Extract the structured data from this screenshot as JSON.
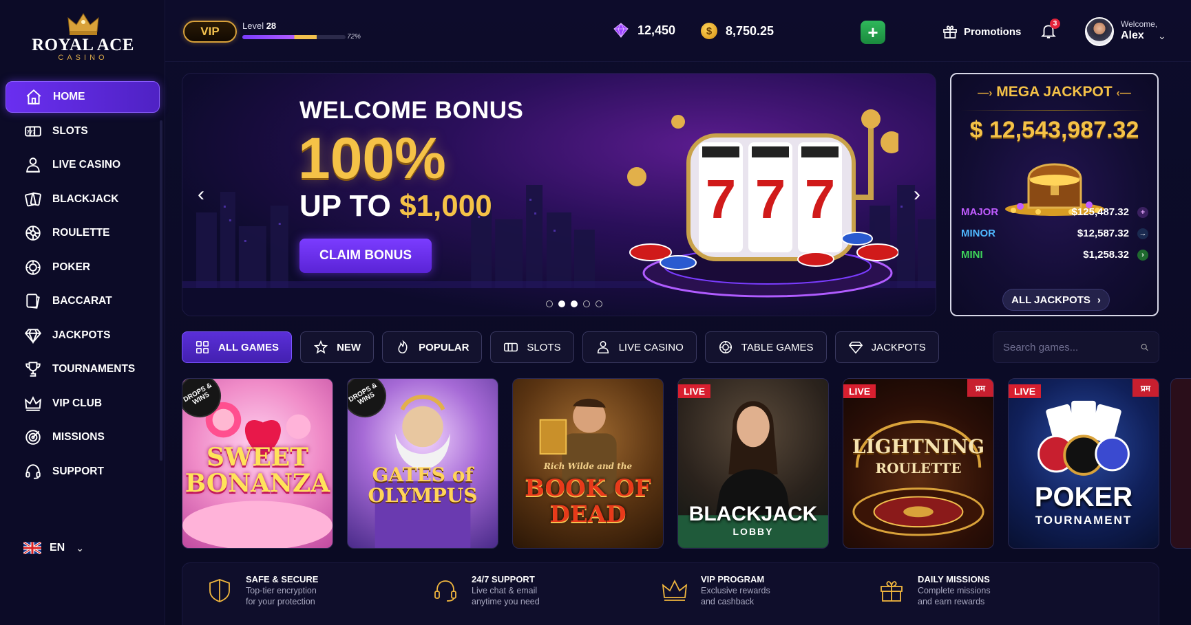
{
  "brand": {
    "name": "ROYAL ACE",
    "sub": "CASINO"
  },
  "sidebar": {
    "items": [
      {
        "label": "HOME",
        "icon": "home-icon",
        "active": true
      },
      {
        "label": "SLOTS",
        "icon": "slots-icon"
      },
      {
        "label": "LIVE CASINO",
        "icon": "dealer-icon"
      },
      {
        "label": "BLACKJACK",
        "icon": "cards-icon"
      },
      {
        "label": "ROULETTE",
        "icon": "roulette-icon"
      },
      {
        "label": "POKER",
        "icon": "chip-icon"
      },
      {
        "label": "BACCARAT",
        "icon": "baccarat-icon"
      },
      {
        "label": "JACKPOTS",
        "icon": "diamond-icon"
      },
      {
        "label": "TOURNAMENTS",
        "icon": "trophy-icon"
      },
      {
        "label": "VIP CLUB",
        "icon": "crown-icon"
      },
      {
        "label": "MISSIONS",
        "icon": "target-icon"
      },
      {
        "label": "SUPPORT",
        "icon": "headset-icon"
      }
    ],
    "language": "EN"
  },
  "header": {
    "vip_label": "VIP",
    "level_label": "Level",
    "level_value": "28",
    "level_progress_pct": "72%",
    "level_progress": 0.72,
    "gems": "12,450",
    "coin_symbol": "$",
    "coins": "8,750.25",
    "add_label": "+",
    "promotions": "Promotions",
    "notifications": "3",
    "welcome": "Welcome,",
    "user": "Alex"
  },
  "hero": {
    "title": "WELCOME BONUS",
    "percent": "100%",
    "upto": "UP TO",
    "amount": "$1,000",
    "cta": "CLAIM BONUS",
    "slides": 5,
    "active_slide": 2
  },
  "jackpot": {
    "title": "MEGA JACKPOT",
    "amount": "$ 12,543,987.32",
    "tiers": [
      {
        "name": "MAJOR",
        "value": "$125,487.32",
        "color": "#c05cff"
      },
      {
        "name": "MINOR",
        "value": "$12,587.32",
        "color": "#4fb8ff"
      },
      {
        "name": "MINI",
        "value": "$1,258.32",
        "color": "#3ed45a"
      }
    ],
    "all_label": "ALL JACKPOTS"
  },
  "filters": {
    "chips": [
      {
        "label": "ALL GAMES",
        "icon": "grid-icon",
        "active": true
      },
      {
        "label": "NEW",
        "icon": "star-icon"
      },
      {
        "label": "POPULAR",
        "icon": "fire-icon"
      },
      {
        "label": "SLOTS",
        "icon": "slots-icon"
      },
      {
        "label": "LIVE CASINO",
        "icon": "dealer-icon"
      },
      {
        "label": "TABLE GAMES",
        "icon": "chip-icon"
      },
      {
        "label": "JACKPOTS",
        "icon": "diamond-icon"
      }
    ],
    "search_placeholder": "Search games..."
  },
  "games": [
    {
      "title": "SWEET BONANZA",
      "badge": "DROPS & WINS",
      "live": ""
    },
    {
      "title": "GATES of OLYMPUS",
      "badge": "DROPS & WINS",
      "live": ""
    },
    {
      "title": "BOOK OF DEAD",
      "subtitle": "Rich Wilde and the",
      "badge": "",
      "live": ""
    },
    {
      "title": "BLACKJACK",
      "subtitle": "LOBBY",
      "live": "LIVE"
    },
    {
      "title": "LIGHTNING",
      "subtitle": "ROULETTE",
      "live": "LIVE",
      "corner": "प्रम"
    },
    {
      "title": "POKER",
      "subtitle": "TOURNAMENT",
      "live": "LIVE",
      "corner": "प्रम"
    }
  ],
  "features": [
    {
      "title": "SAFE & SECURE",
      "line1": "Top-tier encryption",
      "line2": "for your protection",
      "icon": "shield-icon"
    },
    {
      "title": "24/7 SUPPORT",
      "line1": "Live chat & email",
      "line2": "anytime you need",
      "icon": "headset-icon"
    },
    {
      "title": "VIP PROGRAM",
      "line1": "Exclusive rewards",
      "line2": "and cashback",
      "icon": "crown-icon"
    },
    {
      "title": "DAILY MISSIONS",
      "line1": "Complete missions",
      "line2": "and earn rewards",
      "icon": "gift-icon"
    }
  ]
}
